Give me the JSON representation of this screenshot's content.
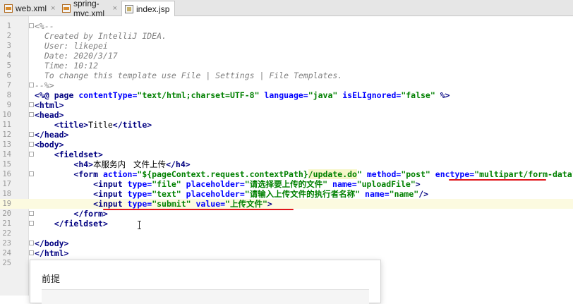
{
  "tabs": [
    {
      "label": "web.xml",
      "icon": "xml-file-icon",
      "active": false
    },
    {
      "label": "spring-mvc.xml",
      "icon": "xml-file-icon",
      "active": false
    },
    {
      "label": "index.jsp",
      "icon": "jsp-file-icon",
      "active": true
    }
  ],
  "close_glyph": "×",
  "editor": {
    "line_numbers": [
      "1",
      "2",
      "3",
      "4",
      "5",
      "6",
      "7",
      "8",
      "9",
      "10",
      "11",
      "12",
      "13",
      "14",
      "15",
      "16",
      "17",
      "18",
      "19",
      "20",
      "21",
      "22",
      "23",
      "24",
      "25"
    ],
    "current_line": 19,
    "lines": [
      [
        {
          "t": "<%--",
          "c": "cm"
        }
      ],
      [
        {
          "t": "  Created by IntelliJ IDEA.",
          "c": "cm"
        }
      ],
      [
        {
          "t": "  User: likepei",
          "c": "cm"
        }
      ],
      [
        {
          "t": "  Date: 2020/3/17",
          "c": "cm"
        }
      ],
      [
        {
          "t": "  Time: 10:12",
          "c": "cm"
        }
      ],
      [
        {
          "t": "  To change this template use File | Settings | File Templates.",
          "c": "cm"
        }
      ],
      [
        {
          "t": "--%>",
          "c": "cm"
        }
      ],
      [
        {
          "t": "<%@ page ",
          "c": "tg"
        },
        {
          "t": "contentType=",
          "c": "at"
        },
        {
          "t": "\"text/html;charset=UTF-8\"",
          "c": "st"
        },
        {
          "t": " language=",
          "c": "at"
        },
        {
          "t": "\"java\"",
          "c": "st"
        },
        {
          "t": " isELIgnored=",
          "c": "at"
        },
        {
          "t": "\"false\"",
          "c": "st"
        },
        {
          "t": " %>",
          "c": "tg"
        }
      ],
      [
        {
          "t": "<html>",
          "c": "tg"
        }
      ],
      [
        {
          "t": "<head>",
          "c": "tg"
        }
      ],
      [
        {
          "t": "    ",
          "c": "pl"
        },
        {
          "t": "<title>",
          "c": "tg"
        },
        {
          "t": "Title",
          "c": "pl"
        },
        {
          "t": "</title>",
          "c": "tg"
        }
      ],
      [
        {
          "t": "</head>",
          "c": "tg"
        }
      ],
      [
        {
          "t": "<body>",
          "c": "tg"
        }
      ],
      [
        {
          "t": "    ",
          "c": "pl"
        },
        {
          "t": "<fieldset>",
          "c": "tg"
        }
      ],
      [
        {
          "t": "        ",
          "c": "pl"
        },
        {
          "t": "<h4>",
          "c": "tg"
        },
        {
          "t": "本服务内   文件上传",
          "c": "cn"
        },
        {
          "t": "</h4>",
          "c": "tg"
        }
      ],
      [
        {
          "t": "        ",
          "c": "pl"
        },
        {
          "t": "<form ",
          "c": "tg"
        },
        {
          "t": "action=",
          "c": "at"
        },
        {
          "t": "\"${pageContext.request.contextPath}",
          "c": "st"
        },
        {
          "t": "/update.do",
          "c": "st hl"
        },
        {
          "t": "\"",
          "c": "st"
        },
        {
          "t": " method=",
          "c": "at"
        },
        {
          "t": "\"post\"",
          "c": "st"
        },
        {
          "t": " enctype=",
          "c": "at"
        },
        {
          "t": "\"multipart/form-data\"",
          "c": "st"
        },
        {
          "t": ">",
          "c": "tg"
        }
      ],
      [
        {
          "t": "            ",
          "c": "pl"
        },
        {
          "t": "<input ",
          "c": "tg"
        },
        {
          "t": "type=",
          "c": "at"
        },
        {
          "t": "\"file\"",
          "c": "st"
        },
        {
          "t": " placeholder=",
          "c": "at"
        },
        {
          "t": "\"请选择要上传的文件\"",
          "c": "st"
        },
        {
          "t": " name=",
          "c": "at"
        },
        {
          "t": "\"uploadFile\"",
          "c": "st"
        },
        {
          "t": ">",
          "c": "tg"
        }
      ],
      [
        {
          "t": "            ",
          "c": "pl"
        },
        {
          "t": "<input ",
          "c": "tg"
        },
        {
          "t": "type=",
          "c": "at"
        },
        {
          "t": "\"text\"",
          "c": "st"
        },
        {
          "t": " placeholder=",
          "c": "at"
        },
        {
          "t": "\"请输入上传文件的执行者名称\"",
          "c": "st"
        },
        {
          "t": " name=",
          "c": "at"
        },
        {
          "t": "\"name\"",
          "c": "st"
        },
        {
          "t": "/>",
          "c": "tg"
        }
      ],
      [
        {
          "t": "            ",
          "c": "pl"
        },
        {
          "t": "<input ",
          "c": "tg"
        },
        {
          "t": "type=",
          "c": "at"
        },
        {
          "t": "\"submit\"",
          "c": "st"
        },
        {
          "t": " value=",
          "c": "at"
        },
        {
          "t": "\"上传文件\"",
          "c": "st"
        },
        {
          "t": ">",
          "c": "tg"
        }
      ],
      [
        {
          "t": "        ",
          "c": "pl"
        },
        {
          "t": "</form>",
          "c": "tg"
        }
      ],
      [
        {
          "t": "    ",
          "c": "pl"
        },
        {
          "t": "</fieldset>",
          "c": "tg"
        }
      ],
      [],
      [
        {
          "t": "</body>",
          "c": "tg"
        }
      ],
      [
        {
          "t": "</html>",
          "c": "tg"
        }
      ],
      []
    ]
  },
  "popup": {
    "title": "前提"
  },
  "colors": {
    "underline": "#e0151a",
    "current_line": "#fcfae0"
  }
}
